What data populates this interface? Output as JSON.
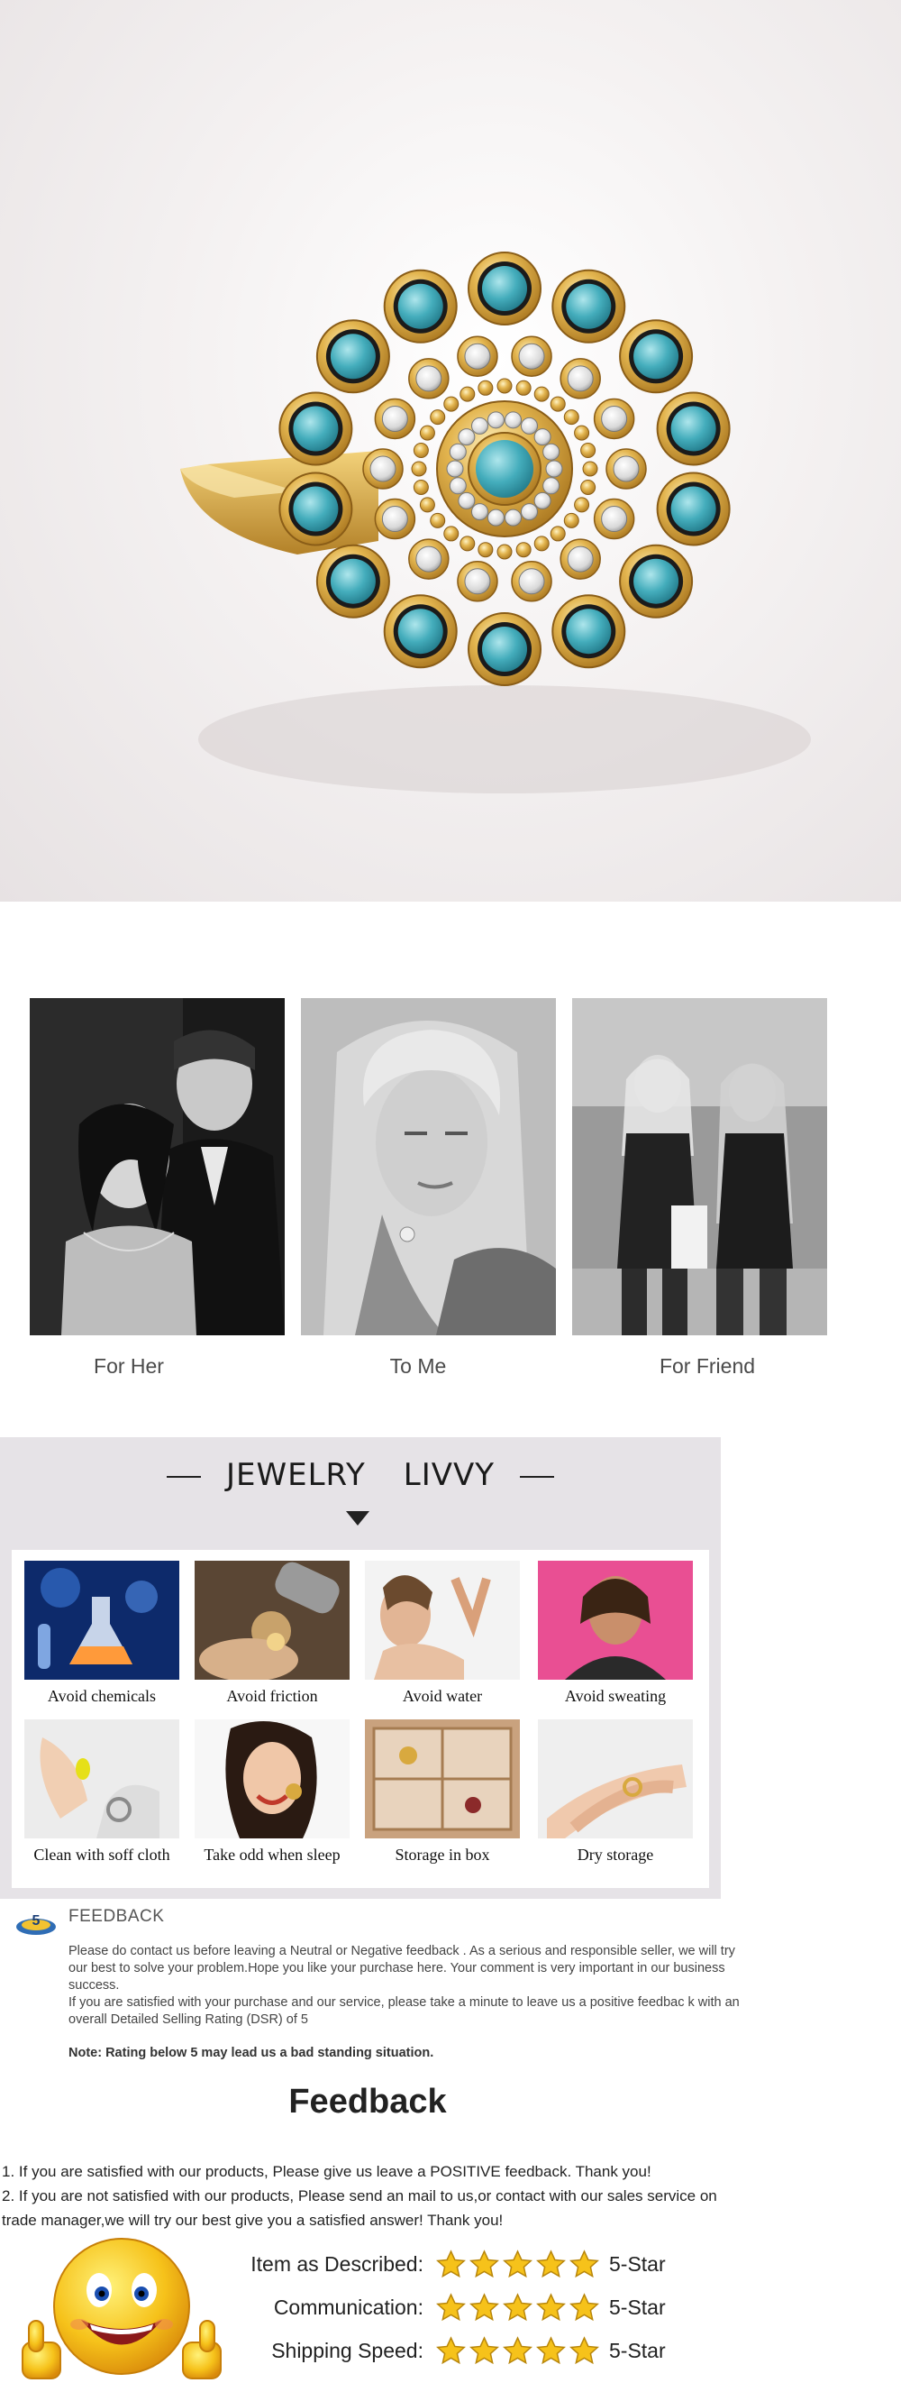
{
  "occasions": [
    {
      "label": "For Her"
    },
    {
      "label": "To Me"
    },
    {
      "label": "For Friend"
    }
  ],
  "care": {
    "title_left": "JEWELRY",
    "title_right": "LIVVY",
    "tips": [
      {
        "label": "Avoid chemicals",
        "icon": "lab-flask-icon"
      },
      {
        "label": "Avoid friction",
        "icon": "polishing-tool-icon"
      },
      {
        "label": "Avoid water",
        "icon": "water-splash-icon"
      },
      {
        "label": "Avoid sweating",
        "icon": "sweat-woman-icon"
      },
      {
        "label": "Clean with soff cloth",
        "icon": "cleaning-cloth-icon"
      },
      {
        "label": "Take odd when sleep",
        "icon": "sleeping-woman-icon"
      },
      {
        "label": "Storage in box",
        "icon": "jewelry-box-icon"
      },
      {
        "label": "Dry storage",
        "icon": "ring-hand-icon"
      }
    ]
  },
  "feedback": {
    "heading": "FEEDBACK",
    "para1": "Please do contact us before leaving a Neutral or Negative  feedback . As a serious and responsible seller, we will try our best to solve your problem.Hope you like your purchase here. Your comment is very important in our business success.",
    "para2": " If you are satisfied with your purchase and our service,  please take a minute to leave us  a positive feedbac k with an overall  Detailed Selling Rating (DSR) of 5",
    "note": "Note: Rating below 5 may lead us a bad standing situation.",
    "big_title": "Feedback",
    "line1": "1. If you are satisfied with our products, Please give us leave a POSITIVE feedback. Thank you!",
    "line2": "2. If you are not satisfied with our products, Please send an mail to us,or contact with our sales service on trade manager,we will try our best give you a satisfied answer! Thank you!",
    "badge_number": "5"
  },
  "ratings": [
    {
      "label": "Item as Described:",
      "stars": 5,
      "value": "5-Star"
    },
    {
      "label": "Communication:",
      "stars": 5,
      "value": "5-Star"
    },
    {
      "label": "Shipping Speed:",
      "stars": 5,
      "value": "5-Star"
    }
  ],
  "colors": {
    "gold": "#d8a93f",
    "turquoise": "#3fa9b8",
    "care_bg": "#e6e3e7",
    "star": "#f6c21a"
  }
}
